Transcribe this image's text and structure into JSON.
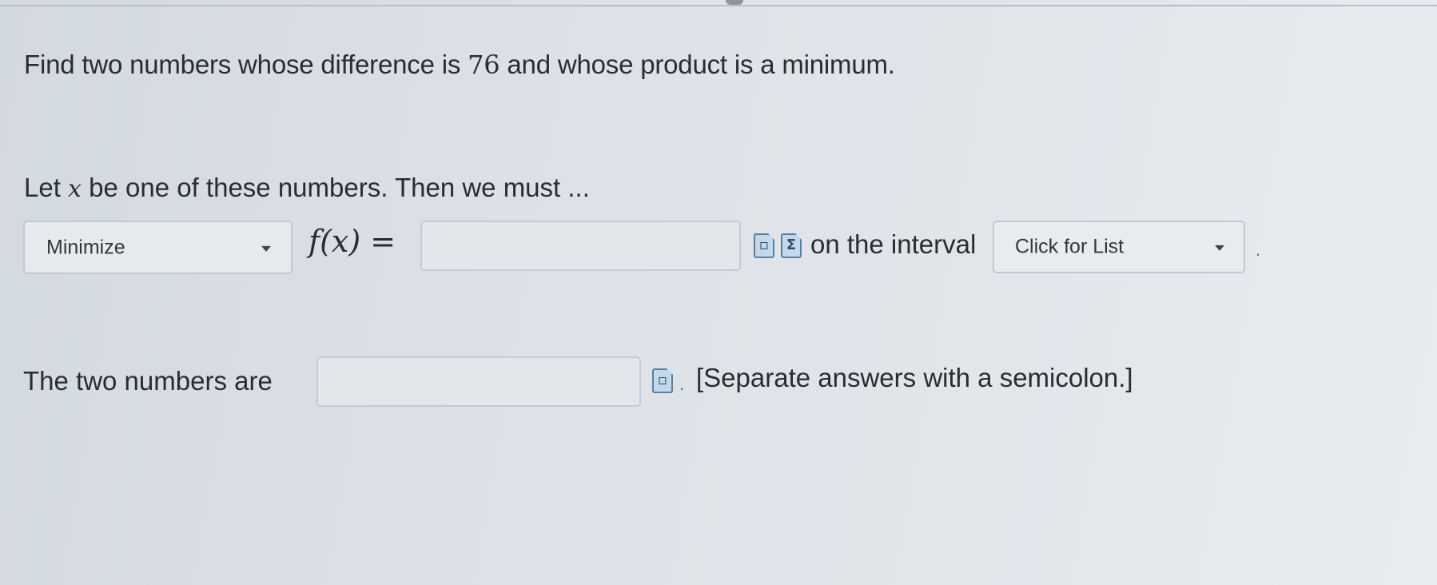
{
  "question": {
    "prefix": "Find two numbers whose difference is ",
    "number": "76",
    "suffix": " and whose product is a minimum."
  },
  "setup": {
    "prefix": "Let ",
    "variable": "x",
    "suffix": " be one of these numbers. Then we must ..."
  },
  "objective_dropdown": {
    "selected": "Minimize"
  },
  "function_label": "f(x) =",
  "function_input": {
    "value": ""
  },
  "interval_text": "on the interval",
  "interval_dropdown": {
    "selected": "Click for List"
  },
  "answer_row": {
    "label": "The two numbers are",
    "value": "",
    "period": ".",
    "hint": "[Separate answers with a semicolon.]"
  },
  "trailing_period": ".",
  "icons": {
    "preview": "preview-icon",
    "symbol": "sigma-icon"
  }
}
